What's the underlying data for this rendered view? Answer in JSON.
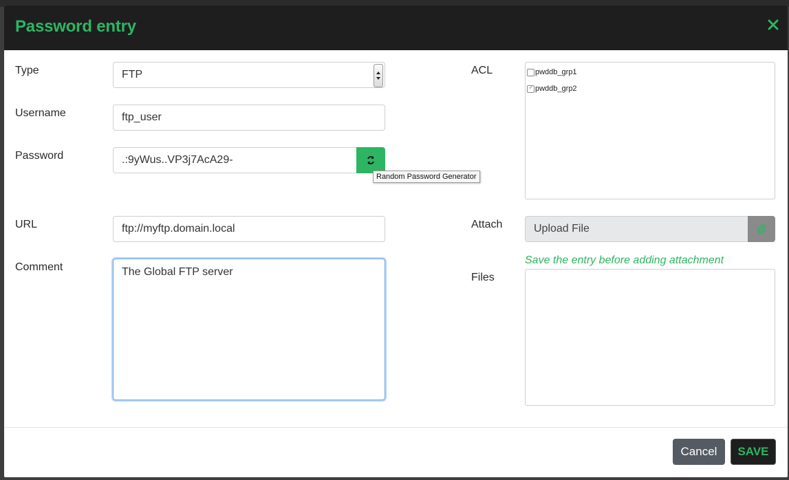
{
  "dialog": {
    "title": "Password entry"
  },
  "form": {
    "type": {
      "label": "Type",
      "value": "FTP"
    },
    "username": {
      "label": "Username",
      "value": "ftp_user"
    },
    "password": {
      "label": "Password",
      "value": ".:9yWus..VP3j7AcA29-",
      "generator_tooltip": "Random Password Generator"
    },
    "url": {
      "label": "URL",
      "value": "ftp://myftp.domain.local"
    },
    "comment": {
      "label": "Comment",
      "value": "The Global FTP server"
    }
  },
  "acl": {
    "label": "ACL",
    "groups": [
      {
        "name": "pwddb_grp1",
        "checked": false
      },
      {
        "name": "pwddb_grp2",
        "checked": true
      }
    ]
  },
  "attach": {
    "label": "Attach",
    "placeholder": "Upload File",
    "hint": "Save the entry before adding attachment"
  },
  "files": {
    "label": "Files"
  },
  "footer": {
    "cancel_label": "Cancel",
    "save_label": "SAVE"
  },
  "colors": {
    "accent": "#2db563",
    "header": "#1e1e1e"
  }
}
